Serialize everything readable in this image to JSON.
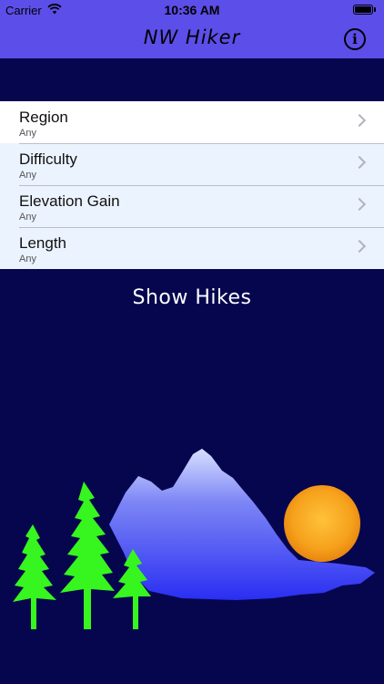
{
  "status_bar": {
    "carrier": "Carrier",
    "time": "10:36 AM"
  },
  "nav": {
    "title": "NW Hiker",
    "info_icon": "info-icon"
  },
  "filters": [
    {
      "label": "Region",
      "value": "Any"
    },
    {
      "label": "Difficulty",
      "value": "Any"
    },
    {
      "label": "Elevation Gain",
      "value": "Any"
    },
    {
      "label": "Length",
      "value": "Any"
    }
  ],
  "action": {
    "show_hikes_label": "Show Hikes"
  },
  "colors": {
    "header": "#5c4ee8",
    "background": "#06064f",
    "row_bg": "#ebf3ff",
    "trees": "#37f51e",
    "sun": "#f4a320"
  }
}
